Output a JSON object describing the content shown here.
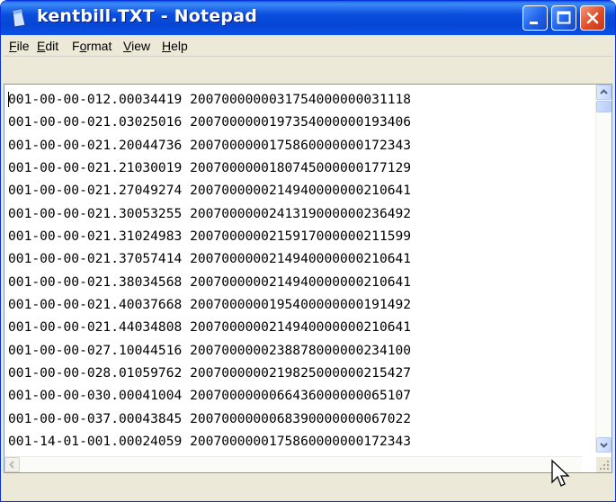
{
  "window": {
    "title": "kentbill.TXT - Notepad",
    "accent": "#0a4ede"
  },
  "menu": {
    "items": [
      {
        "label_u": "F",
        "label_rest": "ile"
      },
      {
        "label_u": "E",
        "label_rest": "dit"
      },
      {
        "label_pre": "F",
        "label_u": "o",
        "label_rest": "rmat"
      },
      {
        "label_u": "V",
        "label_rest": "iew"
      },
      {
        "label_u": "H",
        "label_rest": "elp"
      }
    ]
  },
  "document": {
    "lines": [
      "001-00-00-012.00034419 2007000000031754000000031118",
      "001-00-00-021.03025016 2007000000197354000000193406",
      "001-00-00-021.20044736 2007000000175860000000172343",
      "001-00-00-021.21030019 2007000000180745000000177129",
      "001-00-00-021.27049274 2007000000214940000000210641",
      "001-00-00-021.30053255 2007000000241319000000236492",
      "001-00-00-021.31024983 2007000000215917000000211599",
      "001-00-00-021.37057414 2007000000214940000000210641",
      "001-00-00-021.38034568 2007000000214940000000210641",
      "001-00-00-021.40037668 2007000000195400000000191492",
      "001-00-00-021.44034808 2007000000214940000000210641",
      "001-00-00-027.10044516 2007000000238878000000234100",
      "001-00-00-028.01059762 2007000000219825000000215427",
      "001-00-00-030.00041004 2007000000066436000000065107",
      "001-00-00-037.00043845 2007000000068390000000067022",
      "001-14-01-001.00024059 2007000000175860000000172343"
    ]
  }
}
